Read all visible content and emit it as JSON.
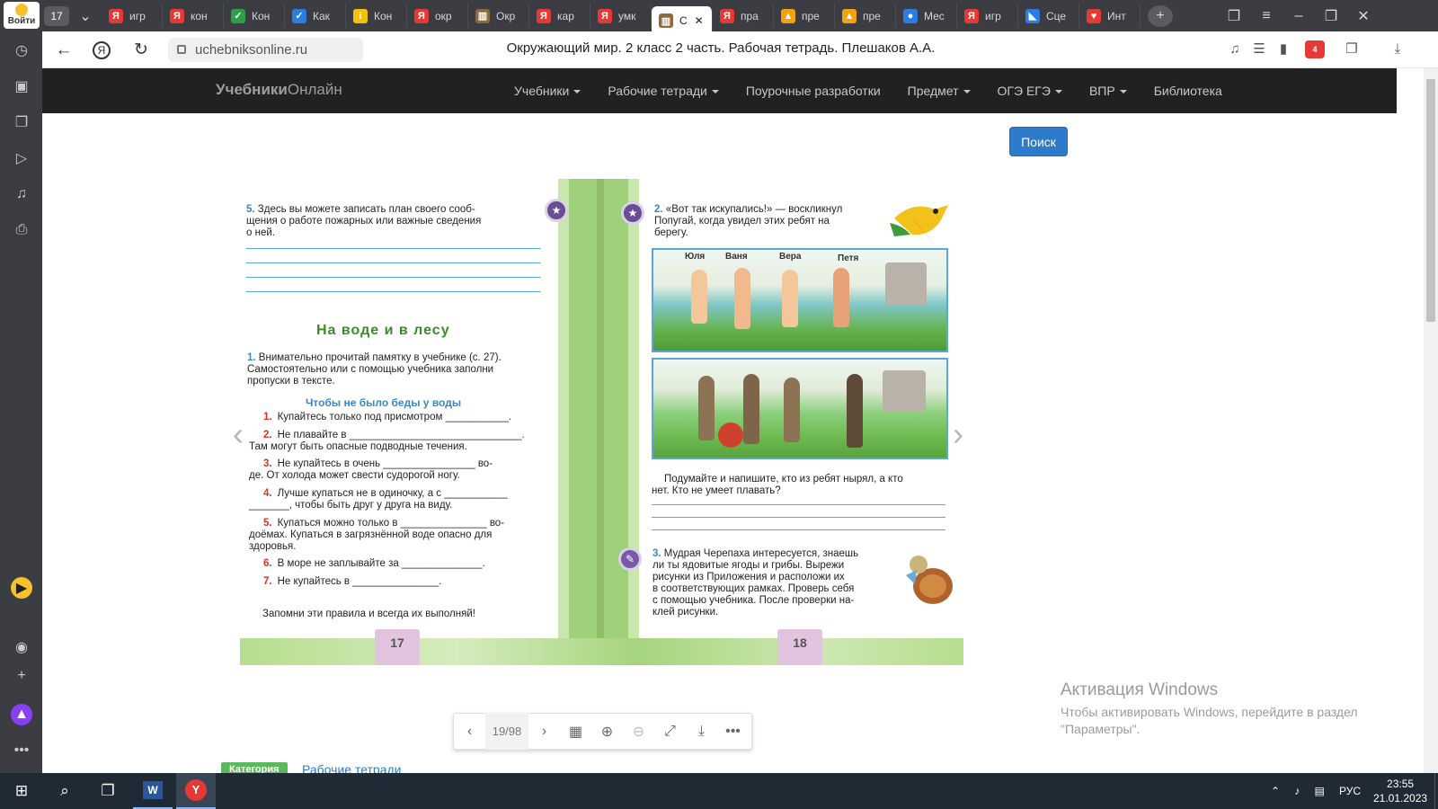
{
  "browser": {
    "login_label": "Войти",
    "tab_counter": "17",
    "tabs": [
      {
        "label": "игр",
        "color": "#e53935",
        "glyph": "Я"
      },
      {
        "label": "кон",
        "color": "#e53935",
        "glyph": "Я"
      },
      {
        "label": "Кон",
        "color": "#2e9f49",
        "glyph": "✓"
      },
      {
        "label": "Как",
        "color": "#2b7de1",
        "glyph": "✓"
      },
      {
        "label": "Кон",
        "color": "#f2c10b",
        "glyph": "i"
      },
      {
        "label": "окр",
        "color": "#e53935",
        "glyph": "Я"
      },
      {
        "label": "Окр",
        "color": "#8c6b3c",
        "glyph": "▥"
      },
      {
        "label": "кар",
        "color": "#e53935",
        "glyph": "Я"
      },
      {
        "label": "умк",
        "color": "#e53935",
        "glyph": "Я"
      },
      {
        "label": "С",
        "color": "#8c6b3c",
        "glyph": "▥",
        "active": true
      },
      {
        "label": "пра",
        "color": "#e53935",
        "glyph": "Я"
      },
      {
        "label": "пре",
        "color": "#f2a30b",
        "glyph": "▲"
      },
      {
        "label": "пре",
        "color": "#f2a30b",
        "glyph": "▲"
      },
      {
        "label": "Мес",
        "color": "#2b7de1",
        "glyph": "●"
      },
      {
        "label": "игр",
        "color": "#e53935",
        "glyph": "Я"
      },
      {
        "label": "Сце",
        "color": "#2b7de1",
        "glyph": "◣"
      },
      {
        "label": "Инт",
        "color": "#e53935",
        "glyph": "♥"
      }
    ],
    "url": "uchebniksonline.ru",
    "page_title": "Окружающий мир. 2 класс 2 часть. Рабочая тетрадь. Плешаков А.А.",
    "adblock_count": "4"
  },
  "site": {
    "brand_bold": "Учебники",
    "brand_rest": "Онлайн",
    "menu": [
      {
        "label": "Учебники",
        "dropdown": true
      },
      {
        "label": "Рабочие тетради",
        "dropdown": true
      },
      {
        "label": "Поурочные разработки",
        "dropdown": false
      },
      {
        "label": "Предмет",
        "dropdown": true
      },
      {
        "label": "ОГЭ ЕГЭ",
        "dropdown": true
      },
      {
        "label": "ВПР",
        "dropdown": true
      },
      {
        "label": "Библиотека",
        "dropdown": false
      }
    ],
    "search_label": "Поиск"
  },
  "book": {
    "left": {
      "task5_num": "5.",
      "task5_lines": [
        "Здесь вы можете записать план своего сооб-",
        "щения о работе пожарных или важные сведения",
        "о ней."
      ],
      "heading": "На воде и в лесу",
      "task1_num": "1.",
      "task1_lines": [
        "Внимательно прочитай памятку в учебнике (с. 27).",
        "Самостоятельно или с помощью учебника заполни",
        "пропуски в тексте."
      ],
      "rules_heading": "Чтобы не было беды у воды",
      "rules": [
        {
          "n": "1.",
          "lines": [
            "Купайтесь только под присмотром ___________."
          ]
        },
        {
          "n": "2.",
          "lines": [
            "Не плавайте в ______________________________.",
            "Там могут быть опасные подводные течения."
          ]
        },
        {
          "n": "3.",
          "lines": [
            "Не купайтесь в очень ________________ во-",
            "де. От холода может свести судорогой ногу."
          ]
        },
        {
          "n": "4.",
          "lines": [
            "Лучше купаться не в одиночку, а с ___________",
            "_______, чтобы быть друг у друга на виду."
          ]
        },
        {
          "n": "5.",
          "lines": [
            "Купаться можно только в _______________ во-",
            "доёмах. Купаться в загрязнённой воде опасно для",
            "здоровья."
          ]
        },
        {
          "n": "6.",
          "lines": [
            "В море не заплывайте за ______________."
          ]
        },
        {
          "n": "7.",
          "lines": [
            "Не купайтесь в _______________."
          ]
        }
      ],
      "remember": "Запомни эти правила и всегда их выполняй!",
      "page_number": "17"
    },
    "right": {
      "task2_num": "2.",
      "task2_lines": [
        "«Вот так искупались!» — воскликнул",
        "Попугай, когда увидел этих ребят на",
        "берегу."
      ],
      "names": [
        "Юля",
        "Ваня",
        "Вера",
        "Петя"
      ],
      "question_lines": [
        "Подумайте и напишите, кто из ребят нырял, а кто",
        "нет. Кто не умеет плавать?"
      ],
      "task3_num": "3.",
      "task3_lines": [
        "Мудрая Черепаха интересуется, знаешь",
        "ли ты ядовитые ягоды и грибы. Вырежи",
        "рисунки из Приложения и расположи их",
        "в соответствующих рамках. Проверь себя",
        "с помощью учебника. После проверки на-",
        "клей рисунки."
      ],
      "page_number": "18"
    }
  },
  "pager": {
    "page": "19/98"
  },
  "category": {
    "badge": "Категория",
    "link": "Рабочие тетради"
  },
  "activation": {
    "title": "Активация Windows",
    "line1": "Чтобы активировать Windows, перейдите в раздел",
    "line2": "\"Параметры\"."
  },
  "taskbar": {
    "lang": "РУС",
    "time": "23:55",
    "date": "21.01.2023"
  }
}
